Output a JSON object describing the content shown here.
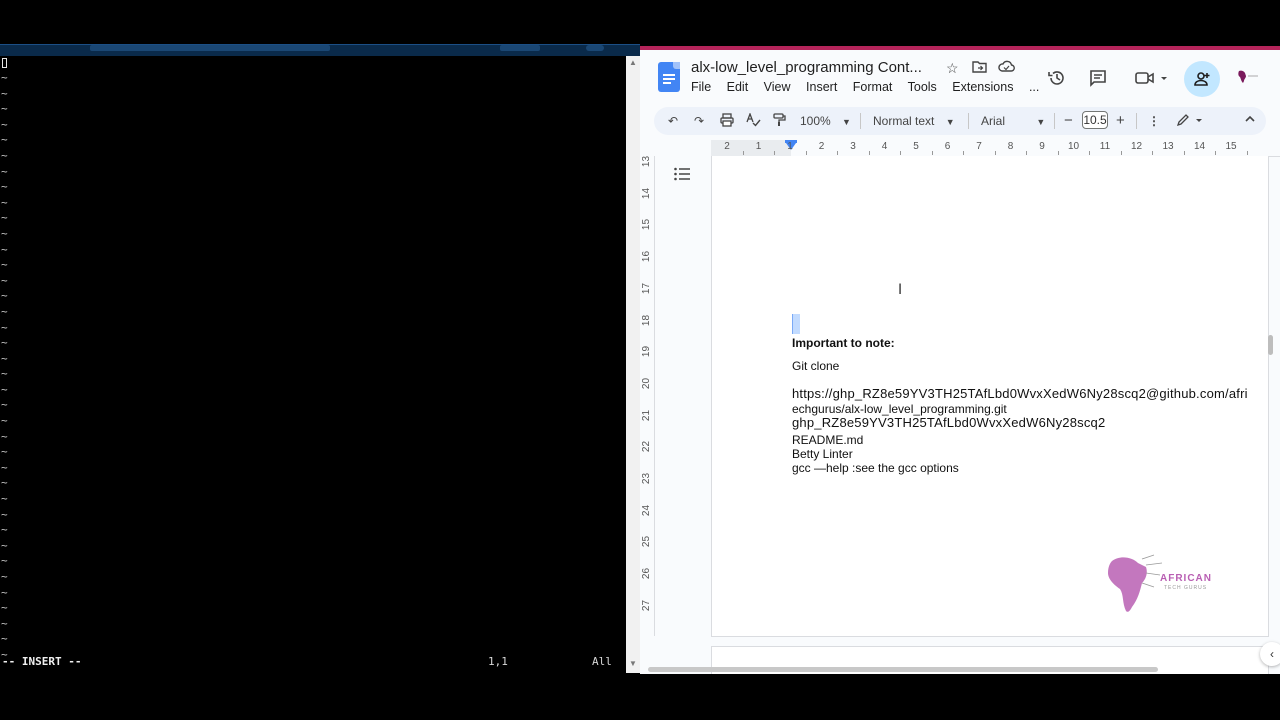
{
  "terminal": {
    "status_mode": "-- INSERT --",
    "status_position": "1,1",
    "status_scroll": "All",
    "tilde": "~",
    "tilde_count": 38
  },
  "docs": {
    "title": "alx-low_level_programming Cont...",
    "menu": [
      "File",
      "Edit",
      "View",
      "Insert",
      "Format",
      "Tools",
      "Extensions",
      "..."
    ],
    "toolbar": {
      "zoom": "100%",
      "style": "Normal text",
      "font": "Arial",
      "font_size": "10.5"
    },
    "ruler_labels": [
      "2",
      "1",
      "1",
      "2",
      "3",
      "4",
      "5",
      "6",
      "7",
      "8",
      "9",
      "10",
      "11",
      "12",
      "13",
      "14",
      "15"
    ],
    "vruler_labels": [
      "13",
      "14",
      "15",
      "16",
      "17",
      "18",
      "19",
      "20",
      "21",
      "22",
      "23",
      "24",
      "25",
      "26",
      "27"
    ],
    "content": {
      "heading": "Important to note:",
      "git_clone": "Git clone",
      "url_line1": "https://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@github.com/afri",
      "url_line2": "echgurus/alx-low_level_programming.git",
      "token": "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",
      "readme": "README.md",
      "betty": "Betty Linter",
      "gcc": "gcc —help :see the gcc options"
    },
    "logo_text": "AFRICAN",
    "logo_subtext": "TECH GURUS",
    "colors": {
      "brand_blue": "#4285f4",
      "share_bg": "#c2e7ff",
      "toolbar_bg": "#edf2fa",
      "top_accent": "#b5245a"
    }
  }
}
